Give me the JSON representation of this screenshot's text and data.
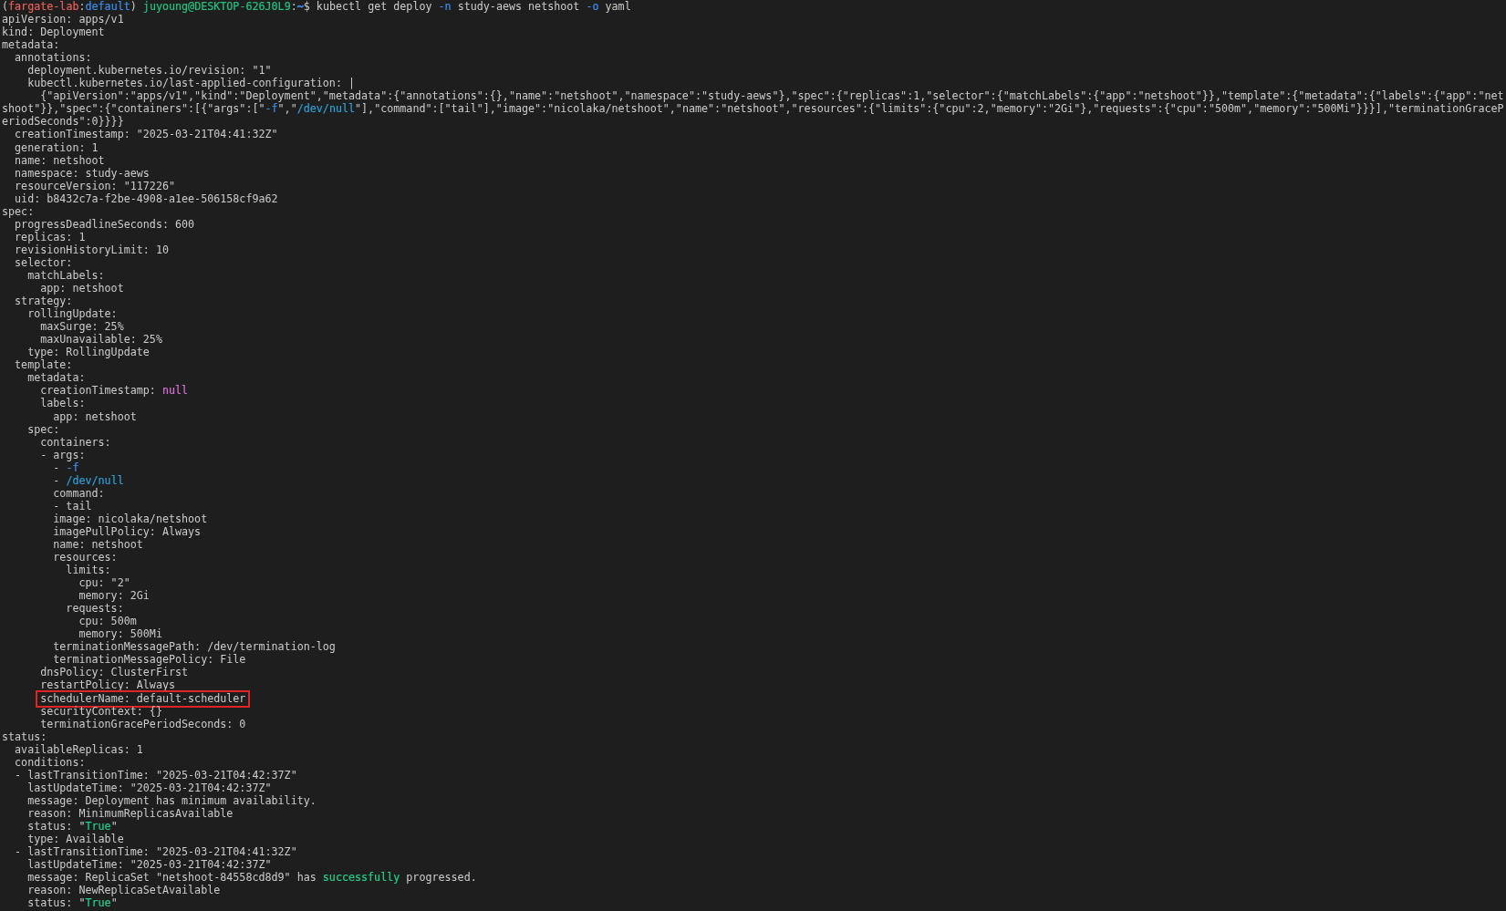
{
  "terminal": {
    "lines": [
      {
        "highlighted": false,
        "segments": [
          {
            "text": "("
          },
          {
            "text": "fargate-lab",
            "color": "#e5605a"
          },
          {
            "text": ":"
          },
          {
            "text": "default",
            "color": "#3b8eea"
          },
          {
            "text": ") "
          },
          {
            "text": "juyoung@DESKTOP-626J0L9",
            "color": "#23c27e"
          },
          {
            "text": ":"
          },
          {
            "text": "~",
            "color": "#3b8eea"
          },
          {
            "text": "$ kubectl get deploy "
          },
          {
            "text": "-n",
            "color": "#3b8eea"
          },
          {
            "text": " study-aews netshoot "
          },
          {
            "text": "-o",
            "color": "#3b8eea"
          },
          {
            "text": " yaml"
          }
        ]
      },
      {
        "highlighted": false,
        "text": "apiVersion: apps/v1"
      },
      {
        "highlighted": false,
        "text": "kind: Deployment"
      },
      {
        "highlighted": false,
        "text": "metadata:"
      },
      {
        "highlighted": false,
        "text": "  annotations:"
      },
      {
        "highlighted": false,
        "text": "    deployment.kubernetes.io/revision: \"1\""
      },
      {
        "highlighted": false,
        "text": "    kubectl.kubernetes.io/last-applied-configuration: |"
      },
      {
        "highlighted": false,
        "text": "      {\"apiVersion\":\"apps/v1\",\"kind\":\"Deployment\",\"metadata\":{\"annotations\":{},\"name\":\"netshoot\",\"namespace\":\"study-aews\"},\"spec\":{\"replicas\":1,\"selector\":{\"matchLabels\":{\"app\":\"netshoot\"}},\"template\":{\"metadata\":{\"labels\":{\"app\":\"net"
      },
      {
        "highlighted": false,
        "segments": [
          {
            "text": "shoot\"}},\"spec\":{\"containers\":[{\"args\":[\""
          },
          {
            "text": "-f",
            "color": "#3b8eea"
          },
          {
            "text": "\",\""
          },
          {
            "text": "/dev/null",
            "color": "#2e9fd6"
          },
          {
            "text": "\"],\"command\":[\"tail\"],\"image\":\"nicolaka/netshoot\",\"name\":\"netshoot\",\"resources\":{\"limits\":{\"cpu\":2,\"memory\":\"2Gi\"},\"requests\":{\"cpu\":\"500m\",\"memory\":\"500Mi\"}}}],\"terminationGraceP"
          }
        ]
      },
      {
        "highlighted": false,
        "text": "eriodSeconds\":0}}}}"
      },
      {
        "highlighted": false,
        "text": "  creationTimestamp: \"2025-03-21T04:41:32Z\""
      },
      {
        "highlighted": false,
        "text": "  generation: 1"
      },
      {
        "highlighted": false,
        "text": "  name: netshoot"
      },
      {
        "highlighted": false,
        "text": "  namespace: study-aews"
      },
      {
        "highlighted": false,
        "text": "  resourceVersion: \"117226\""
      },
      {
        "highlighted": false,
        "text": "  uid: b8432c7a-f2be-4908-a1ee-506158cf9a62"
      },
      {
        "highlighted": false,
        "text": "spec:"
      },
      {
        "highlighted": false,
        "text": "  progressDeadlineSeconds: 600"
      },
      {
        "highlighted": false,
        "text": "  replicas: 1"
      },
      {
        "highlighted": false,
        "text": "  revisionHistoryLimit: 10"
      },
      {
        "highlighted": false,
        "text": "  selector:"
      },
      {
        "highlighted": false,
        "text": "    matchLabels:"
      },
      {
        "highlighted": false,
        "text": "      app: netshoot"
      },
      {
        "highlighted": false,
        "text": "  strategy:"
      },
      {
        "highlighted": false,
        "text": "    rollingUpdate:"
      },
      {
        "highlighted": false,
        "text": "      maxSurge: 25%"
      },
      {
        "highlighted": false,
        "text": "      maxUnavailable: 25%"
      },
      {
        "highlighted": false,
        "text": "    type: RollingUpdate"
      },
      {
        "highlighted": false,
        "text": "  template:"
      },
      {
        "highlighted": false,
        "text": "    metadata:"
      },
      {
        "highlighted": false,
        "segments": [
          {
            "text": "      creationTimestamp: "
          },
          {
            "text": "null",
            "color": "#d670d6"
          }
        ]
      },
      {
        "highlighted": false,
        "text": "      labels:"
      },
      {
        "highlighted": false,
        "text": "        app: netshoot"
      },
      {
        "highlighted": false,
        "text": "    spec:"
      },
      {
        "highlighted": false,
        "text": "      containers:"
      },
      {
        "highlighted": false,
        "text": "      - args:"
      },
      {
        "highlighted": false,
        "segments": [
          {
            "text": "        - "
          },
          {
            "text": "-f",
            "color": "#3b8eea"
          }
        ]
      },
      {
        "highlighted": false,
        "segments": [
          {
            "text": "        - "
          },
          {
            "text": "/dev/null",
            "color": "#2e9fd6"
          }
        ]
      },
      {
        "highlighted": false,
        "text": "        command:"
      },
      {
        "highlighted": false,
        "text": "        - tail"
      },
      {
        "highlighted": false,
        "text": "        image: nicolaka/netshoot"
      },
      {
        "highlighted": false,
        "text": "        imagePullPolicy: Always"
      },
      {
        "highlighted": false,
        "text": "        name: netshoot"
      },
      {
        "highlighted": false,
        "text": "        resources:"
      },
      {
        "highlighted": false,
        "text": "          limits:"
      },
      {
        "highlighted": false,
        "text": "            cpu: \"2\""
      },
      {
        "highlighted": false,
        "text": "            memory: 2Gi"
      },
      {
        "highlighted": false,
        "text": "          requests:"
      },
      {
        "highlighted": false,
        "text": "            cpu: 500m"
      },
      {
        "highlighted": false,
        "text": "            memory: 500Mi"
      },
      {
        "highlighted": false,
        "text": "        terminationMessagePath: /dev/termination-log"
      },
      {
        "highlighted": false,
        "text": "        terminationMessagePolicy: File"
      },
      {
        "highlighted": false,
        "text": "      dnsPolicy: ClusterFirst"
      },
      {
        "highlighted": false,
        "text": "      restartPolicy: Always"
      },
      {
        "highlighted": true,
        "text": "      schedulerName: default-scheduler"
      },
      {
        "highlighted": false,
        "text": "      securityContext: {}"
      },
      {
        "highlighted": false,
        "text": "      terminationGracePeriodSeconds: 0"
      },
      {
        "highlighted": false,
        "text": "status:"
      },
      {
        "highlighted": false,
        "text": "  availableReplicas: 1"
      },
      {
        "highlighted": false,
        "text": "  conditions:"
      },
      {
        "highlighted": false,
        "text": "  - lastTransitionTime: \"2025-03-21T04:42:37Z\""
      },
      {
        "highlighted": false,
        "text": "    lastUpdateTime: \"2025-03-21T04:42:37Z\""
      },
      {
        "highlighted": false,
        "text": "    message: Deployment has minimum availability."
      },
      {
        "highlighted": false,
        "text": "    reason: MinimumReplicasAvailable"
      },
      {
        "highlighted": false,
        "segments": [
          {
            "text": "    status: \""
          },
          {
            "text": "True",
            "color": "#23d18b"
          },
          {
            "text": "\""
          }
        ]
      },
      {
        "highlighted": false,
        "text": "    type: Available"
      },
      {
        "highlighted": false,
        "text": "  - lastTransitionTime: \"2025-03-21T04:41:32Z\""
      },
      {
        "highlighted": false,
        "text": "    lastUpdateTime: \"2025-03-21T04:42:37Z\""
      },
      {
        "highlighted": false,
        "segments": [
          {
            "text": "    message: ReplicaSet \"netshoot-84558cd8d9\" has "
          },
          {
            "text": "successfully",
            "color": "#23d18b"
          },
          {
            "text": " progressed."
          }
        ]
      },
      {
        "highlighted": false,
        "text": "    reason: NewReplicaSetAvailable"
      },
      {
        "highlighted": false,
        "segments": [
          {
            "text": "    status: \""
          },
          {
            "text": "True",
            "color": "#23d18b"
          },
          {
            "text": "\""
          }
        ]
      }
    ]
  }
}
